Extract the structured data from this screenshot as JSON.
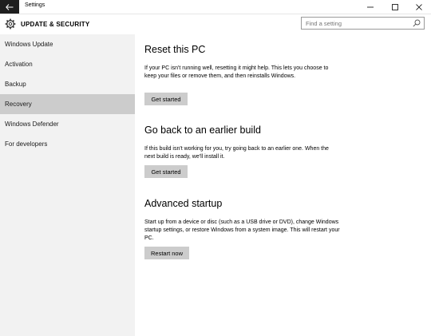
{
  "window": {
    "title": "Settings",
    "back_icon": "back-arrow-icon",
    "minimize_icon": "minimize-icon",
    "maximize_icon": "maximize-icon",
    "close_icon": "close-icon"
  },
  "header": {
    "title": "UPDATE & SECURITY",
    "icon": "gear-icon"
  },
  "search": {
    "placeholder": "Find a setting",
    "icon": "search-icon"
  },
  "sidebar": {
    "items": [
      {
        "label": "Windows Update"
      },
      {
        "label": "Activation"
      },
      {
        "label": "Backup"
      },
      {
        "label": "Recovery",
        "selected": true
      },
      {
        "label": "Windows Defender"
      },
      {
        "label": "For developers"
      }
    ]
  },
  "main": {
    "sections": [
      {
        "title": "Reset this PC",
        "text": "If your PC isn't running well, resetting it might help. This lets you choose to keep your files or remove them, and then reinstalls Windows.",
        "button": "Get started"
      },
      {
        "title": "Go back to an earlier build",
        "text": "If this build isn't working for you, try going back to an earlier one. When the next build is ready, we'll install it.",
        "button": "Get started"
      },
      {
        "title": "Advanced startup",
        "text": "Start up from a device or disc (such as a USB drive or DVD), change Windows startup settings, or restore Windows from a system image. This will restart your PC.",
        "button": "Restart now"
      }
    ]
  },
  "colors": {
    "sidebar_bg": "#f2f2f2",
    "selected_bg": "#cccccc",
    "button_bg": "#cccccc",
    "back_button_bg": "#1f1f1f"
  }
}
